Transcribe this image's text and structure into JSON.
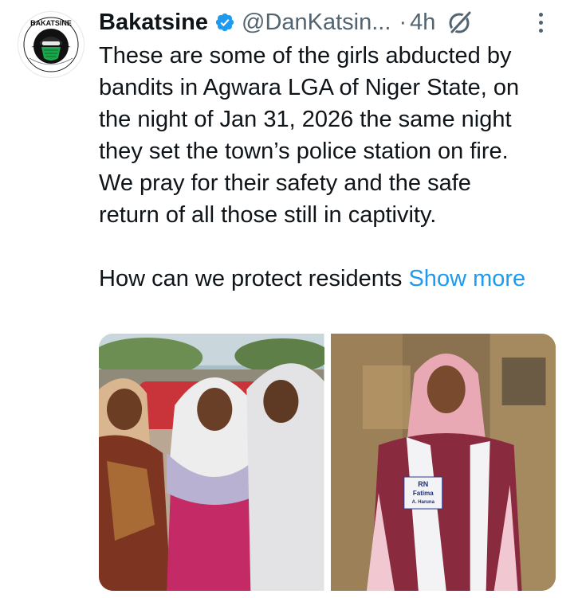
{
  "tweet": {
    "display_name": "Bakatsine",
    "handle": "@DanKatsin...",
    "separator": "·",
    "time": "4h",
    "text_lines": [
      "These are some of the girls abducted by",
      "bandits in Agwara LGA of Niger State, on",
      "the night of Jan 31, 2026 the same night",
      "they set the town’s police station on fire.",
      "We pray for their safety and the safe",
      "return of all those still in captivity."
    ],
    "second_paragraph": "How can we protect residents",
    "show_more_label": "Show more"
  },
  "avatar": {
    "logo_text": "BAKATSINE"
  },
  "media": {
    "photo_right_sash_text": [
      "RN",
      "Fatima",
      "A. Haruna"
    ]
  },
  "icons": {
    "verified": "verified-badge-icon",
    "grok": "grok-icon",
    "more": "more-options-icon"
  },
  "colors": {
    "accent": "#1d9bf0",
    "secondary_text": "#536471",
    "primary_text": "#0f1419"
  }
}
